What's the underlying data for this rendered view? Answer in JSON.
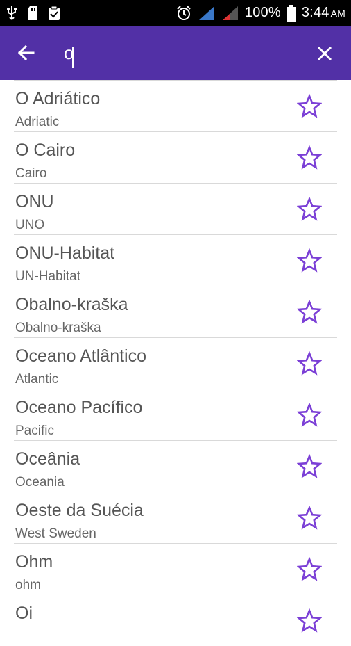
{
  "status_bar": {
    "battery": "100%",
    "time": "3:44",
    "ampm": "AM"
  },
  "toolbar": {
    "search_value": "o",
    "accent": "#5230a6"
  },
  "colors": {
    "star": "#7b3fd6",
    "divider": "#d9d9d9"
  },
  "results": [
    {
      "title": "O Adriático",
      "subtitle": "Adriatic"
    },
    {
      "title": "O Cairo",
      "subtitle": "Cairo"
    },
    {
      "title": "ONU",
      "subtitle": "UNO"
    },
    {
      "title": "ONU-Habitat",
      "subtitle": "UN-Habitat"
    },
    {
      "title": "Obalno-kraška",
      "subtitle": "Obalno-kraška"
    },
    {
      "title": "Oceano Atlântico",
      "subtitle": "Atlantic"
    },
    {
      "title": "Oceano Pacífico",
      "subtitle": "Pacific"
    },
    {
      "title": "Oceânia",
      "subtitle": "Oceania"
    },
    {
      "title": "Oeste da Suécia",
      "subtitle": "West Sweden"
    },
    {
      "title": "Ohm",
      "subtitle": "ohm"
    },
    {
      "title": "Oi",
      "subtitle": ""
    }
  ]
}
